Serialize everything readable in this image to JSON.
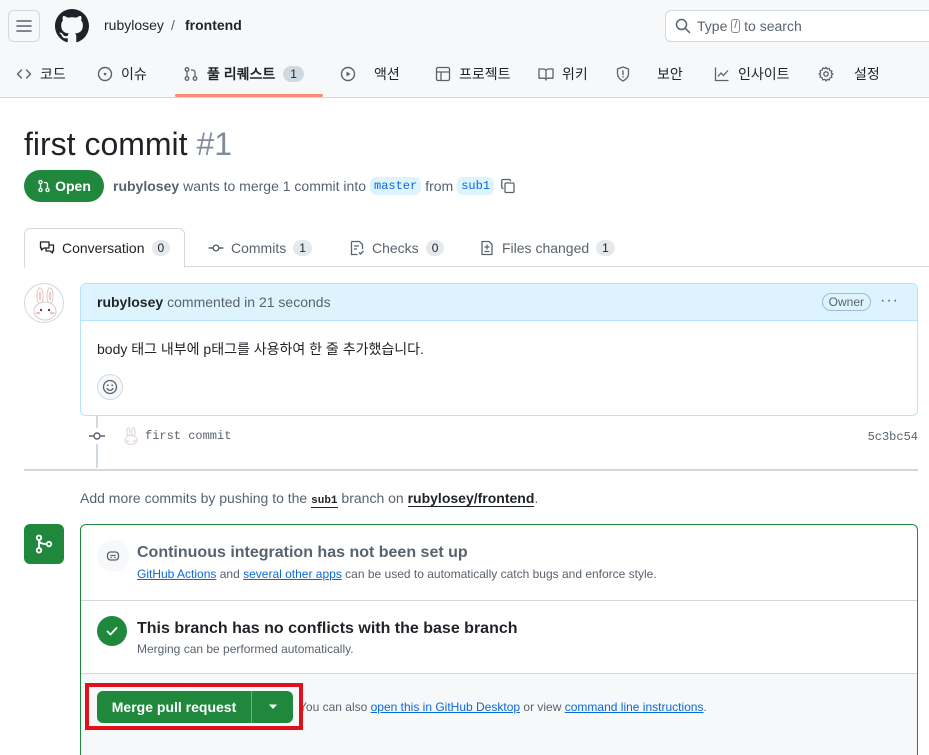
{
  "header": {
    "owner": "rubylosey",
    "separator": "/",
    "repo": "frontend",
    "search_prefix": "Type",
    "search_key": "/",
    "search_suffix": "to search"
  },
  "nav": {
    "items": [
      {
        "label": "코드",
        "icon": "code-icon"
      },
      {
        "label": "이슈",
        "icon": "issue-icon"
      },
      {
        "label": "풀 리퀘스트",
        "icon": "pull-request-icon",
        "count": "1",
        "active": true
      },
      {
        "label": "액션",
        "icon": "play-icon"
      },
      {
        "label": "프로젝트",
        "icon": "table-icon"
      },
      {
        "label": "위키",
        "icon": "book-icon"
      },
      {
        "label": "보안",
        "icon": "shield-icon"
      },
      {
        "label": "인사이트",
        "icon": "graph-icon"
      },
      {
        "label": "설정",
        "icon": "gear-icon"
      }
    ]
  },
  "pr": {
    "title": "first commit",
    "number": "#1",
    "state": "Open",
    "author": "rubylosey",
    "meta_text": "wants to merge 1 commit into",
    "base": "master",
    "from_word": "from",
    "head": "sub1"
  },
  "tabs": [
    {
      "label": "Conversation",
      "count": "0",
      "icon": "comment-discussion-icon"
    },
    {
      "label": "Commits",
      "count": "1",
      "icon": "commit-icon"
    },
    {
      "label": "Checks",
      "count": "0",
      "icon": "checklist-icon"
    },
    {
      "label": "Files changed",
      "count": "1",
      "icon": "file-diff-icon"
    }
  ],
  "comment": {
    "author": "rubylosey",
    "action": "commented in 21 seconds",
    "role": "Owner",
    "menu": "···",
    "body": "body 태그 내부에 p태그를 사용하여 한 줄 추가했습니다."
  },
  "commit": {
    "message": "first commit",
    "sha": "5c3bc54"
  },
  "hint": {
    "prefix": "Add more commits by pushing to the",
    "branch": "sub1",
    "middle": "branch on",
    "repo": "rubylosey/frontend",
    "suffix": "."
  },
  "merge": {
    "ci_title": "Continuous integration has not been set up",
    "ci_link1": "GitHub Actions",
    "ci_and": "and",
    "ci_link2": "several other apps",
    "ci_rest": "can be used to automatically catch bugs and enforce style.",
    "conflict_title": "This branch has no conflicts with the base branch",
    "conflict_sub": "Merging can be performed automatically.",
    "button": "Merge pull request",
    "footer_prefix": "You can also",
    "footer_link1": "open this in GitHub Desktop",
    "footer_mid": "or view",
    "footer_link2": "command line instructions",
    "footer_suffix": "."
  },
  "colors": {
    "accent_green": "#1f883d",
    "link_blue": "#0969da",
    "highlight_red": "#e0111a",
    "nav_underline": "#fd8c73"
  }
}
